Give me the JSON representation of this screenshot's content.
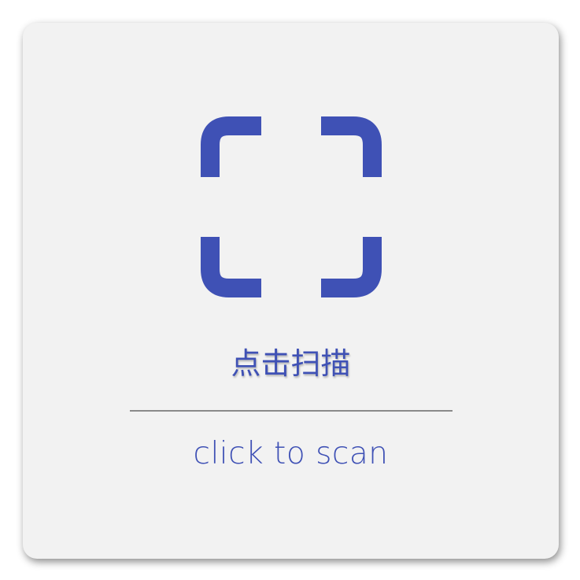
{
  "button": {
    "title_cn": "点击扫描",
    "subtitle_en": "click to scan"
  },
  "icon": "scan-frame-icon",
  "colors": {
    "accent": "#3f51b5",
    "card_background": "#f2f2f2",
    "divider": "#8a8a8a"
  }
}
